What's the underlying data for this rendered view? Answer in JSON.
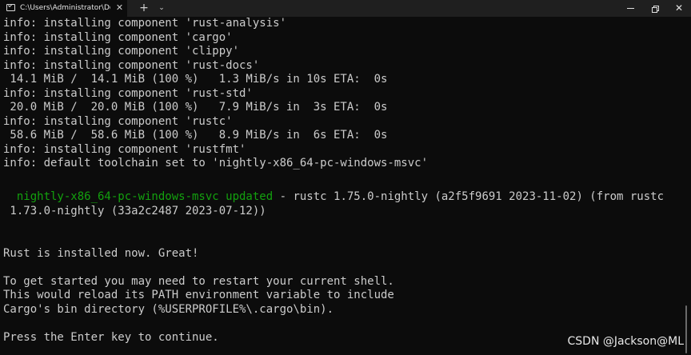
{
  "titlebar": {
    "tab_title": "C:\\Users\\Administrator\\Downl",
    "tab_close_glyph": "✕",
    "new_tab_glyph": "+",
    "dropdown_glyph": "⌄",
    "close_glyph": "✕"
  },
  "terminal": {
    "lines": [
      "info: installing component 'rust-analysis'",
      "info: installing component 'cargo'",
      "info: installing component 'clippy'",
      "info: installing component 'rust-docs'",
      " 14.1 MiB /  14.1 MiB (100 %)   1.3 MiB/s in 10s ETA:  0s",
      "info: installing component 'rust-std'",
      " 20.0 MiB /  20.0 MiB (100 %)   7.9 MiB/s in  3s ETA:  0s",
      "info: installing component 'rustc'",
      " 58.6 MiB /  58.6 MiB (100 %)   8.9 MiB/s in  6s ETA:  0s",
      "info: installing component 'rustfmt'",
      "info: default toolchain set to 'nightly-x86_64-pc-windows-msvc'"
    ],
    "updated_toolchain": "  nightly-x86_64-pc-windows-msvc updated",
    "updated_rest": " - rustc 1.75.0-nightly (a2f5f9691 2023-11-02) (from rustc",
    "updated_cont": " 1.73.0-nightly (33a2c2487 2023-07-12))",
    "installed": "Rust is installed now. Great!",
    "restart_lines": [
      "To get started you may need to restart your current shell.",
      "This would reload its PATH environment variable to include",
      "Cargo's bin directory (%USERPROFILE%\\.cargo\\bin)."
    ],
    "prompt": "Press the Enter key to continue."
  },
  "watermark": "CSDN @Jackson@ML",
  "colors": {
    "background": "#0c0c0c",
    "text": "#cccccc",
    "toolchain_green": "#13a10e",
    "titlebar": "#1f1f1f"
  }
}
